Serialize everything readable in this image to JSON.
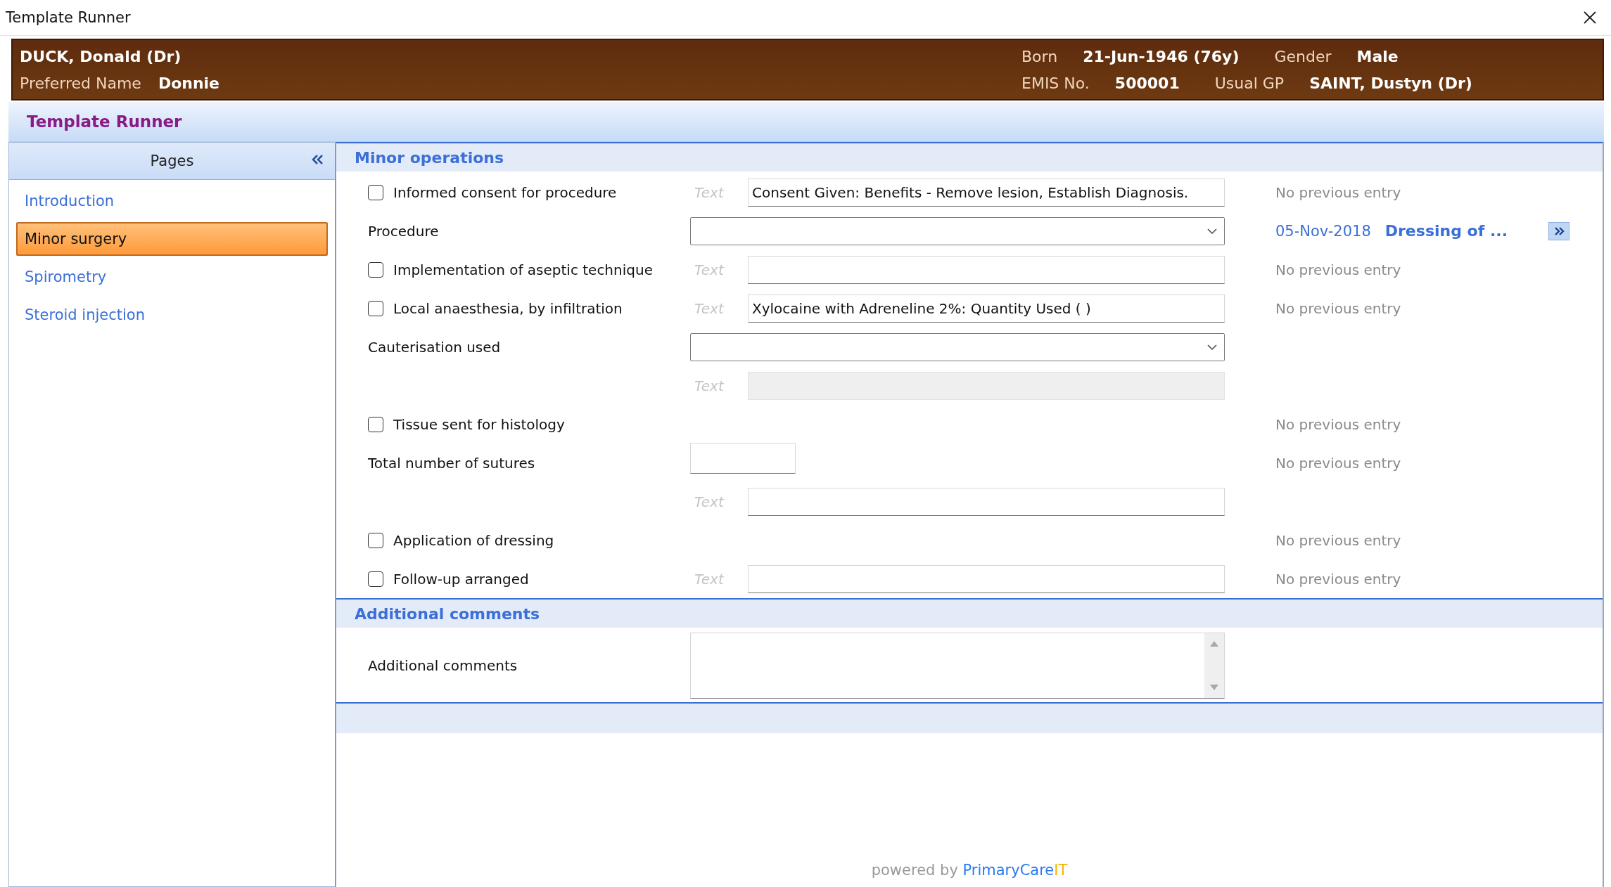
{
  "window": {
    "title": "Template Runner"
  },
  "patient": {
    "name": "DUCK, Donald (Dr)",
    "preferred_name_label": "Preferred Name",
    "preferred_name": "Donnie",
    "rows": [
      [
        {
          "label": "Born",
          "value": "21-Jun-1946 (76y)"
        },
        {
          "label": "Gender",
          "value": "Male"
        }
      ],
      [
        {
          "label": "EMIS No.",
          "value": "500001"
        },
        {
          "label": "Usual GP",
          "value": "SAINT, Dustyn (Dr)"
        }
      ]
    ]
  },
  "header": {
    "title": "Template Runner"
  },
  "pages": {
    "title": "Pages",
    "items": [
      {
        "label": "Introduction",
        "selected": false
      },
      {
        "label": "Minor surgery",
        "selected": true
      },
      {
        "label": "Spirometry",
        "selected": false
      },
      {
        "label": "Steroid injection",
        "selected": false
      }
    ]
  },
  "sections": [
    {
      "title": "Minor operations",
      "rows": [
        {
          "kind": "check",
          "label": "Informed consent for procedure",
          "checked": false,
          "text_label": "Text",
          "value": "Consent Given: Benefits - Remove lesion, Establish Diagnosis.",
          "previous": "No previous entry"
        },
        {
          "kind": "select",
          "label": "Procedure",
          "previous_date": "05-Nov-2018",
          "previous_value": "Dressing of ..."
        },
        {
          "kind": "check",
          "label": "Implementation of aseptic technique",
          "checked": false,
          "text_label": "Text",
          "value": "",
          "previous": "No previous entry"
        },
        {
          "kind": "check",
          "label": "Local anaesthesia, by infiltration",
          "checked": false,
          "text_label": "Text",
          "value": "Xylocaine with Adreneline 2%: Quantity Used ( )",
          "previous": "No previous entry"
        },
        {
          "kind": "select",
          "label": "Cauterisation used"
        },
        {
          "kind": "text",
          "text_label": "Text",
          "disabled": true
        },
        {
          "kind": "check",
          "label": "Tissue sent for histology",
          "checked": false,
          "previous": "No previous entry"
        },
        {
          "kind": "number",
          "label": "Total number of sutures",
          "previous": "No previous entry"
        },
        {
          "kind": "text",
          "text_label": "Text",
          "disabled": false
        },
        {
          "kind": "check",
          "label": "Application of dressing",
          "checked": false,
          "previous": "No previous entry"
        },
        {
          "kind": "check",
          "label": "Follow-up arranged",
          "checked": false,
          "text_label": "Text",
          "value": "",
          "previous": "No previous entry"
        }
      ]
    },
    {
      "title": "Additional comments",
      "rows": [
        {
          "kind": "memo",
          "label": "Additional comments"
        }
      ]
    }
  ],
  "footer": {
    "powered_by": "powered by",
    "brand": "PrimaryCare",
    "brand_suffix": "IT"
  }
}
